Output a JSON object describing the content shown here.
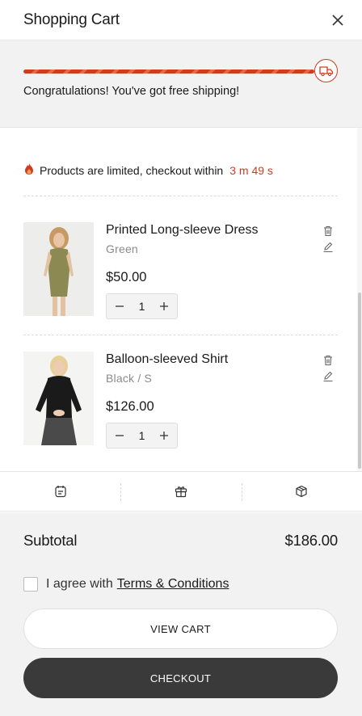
{
  "header": {
    "title": "Shopping Cart"
  },
  "shipping": {
    "message": "Congratulations! You've got free shipping!",
    "progress_percent": 100
  },
  "urgency": {
    "text": "Products are limited, checkout within",
    "timer": "3 m 49 s"
  },
  "items": [
    {
      "name": "Printed Long-sleeve Dress",
      "variant": "Green",
      "price": "$50.00",
      "quantity": "1"
    },
    {
      "name": "Balloon-sleeved Shirt",
      "variant": "Black / S",
      "price": "$126.00",
      "quantity": "1"
    }
  ],
  "tools": [
    "note-icon",
    "gift-icon",
    "box-icon"
  ],
  "summary": {
    "subtotal_label": "Subtotal",
    "subtotal_value": "$186.00"
  },
  "agreement": {
    "prefix": "I agree with",
    "terms_link": "Terms & Conditions"
  },
  "buttons": {
    "view_cart": "VIEW CART",
    "checkout": "CHECKOUT"
  },
  "colors": {
    "accent": "#d23a22",
    "dark_button": "#3a3a3a",
    "panel_bg": "#f2f2f2"
  }
}
